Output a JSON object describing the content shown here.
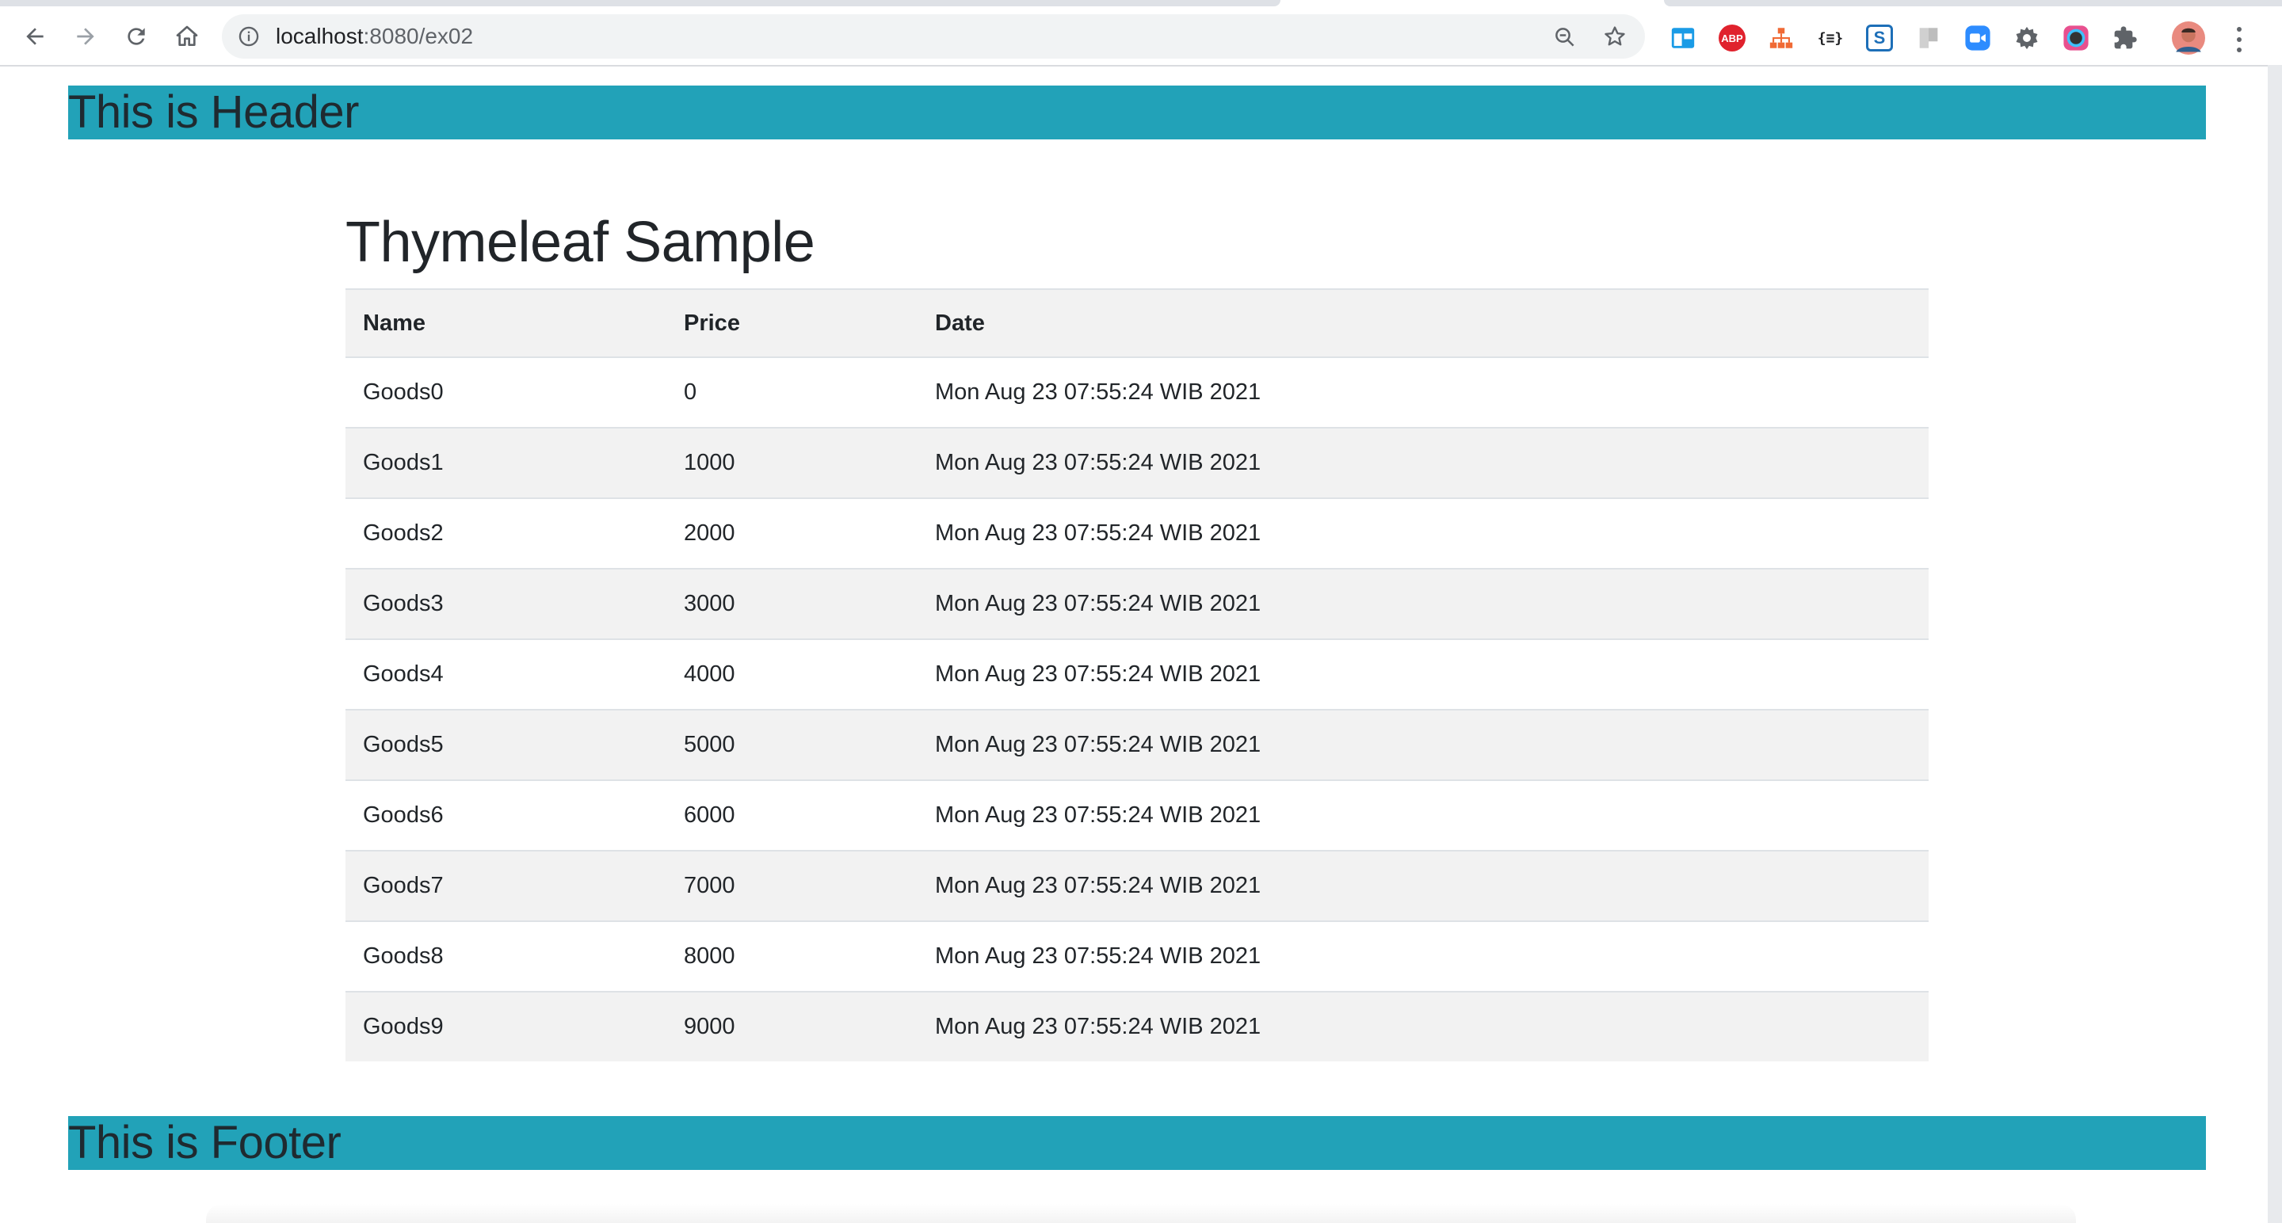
{
  "browser": {
    "url_host": "localhost",
    "url_path": ":8080/ex02",
    "nav": {
      "back": "back-icon",
      "forward": "forward-icon",
      "reload": "reload-icon",
      "home": "home-icon"
    },
    "extensions": [
      {
        "name": "window-ext-icon",
        "label": "",
        "color": "#1a9be6"
      },
      {
        "name": "adblock-icon",
        "label": "ABP",
        "color": "#e0222d"
      },
      {
        "name": "sitemap-ext-icon",
        "label": "",
        "color": "#f06a35"
      },
      {
        "name": "json-ext-icon",
        "label": "{≡}",
        "color": "#202124"
      },
      {
        "name": "s-ext-icon",
        "label": "S",
        "color": "#1d6fb8"
      },
      {
        "name": "grey-ext-icon",
        "label": "",
        "color": "#bdbdbd"
      },
      {
        "name": "zoom-ext-icon",
        "label": "",
        "color": "#2d8cff"
      },
      {
        "name": "gear-ext-icon",
        "label": "",
        "color": "#5f6368"
      },
      {
        "name": "color-picker-ext-icon",
        "label": "",
        "color": "#333333"
      },
      {
        "name": "extensions-puzzle-icon",
        "label": "",
        "color": "#5f6368"
      }
    ]
  },
  "page": {
    "header": "This is Header",
    "title": "Thymeleaf Sample",
    "footer": "This is Footer",
    "colors": {
      "bar": "#22a2b8",
      "stripe": "#f2f2f2"
    },
    "table": {
      "columns": [
        "Name",
        "Price",
        "Date"
      ],
      "rows": [
        [
          "Goods0",
          "0",
          "Mon Aug 23 07:55:24 WIB 2021"
        ],
        [
          "Goods1",
          "1000",
          "Mon Aug 23 07:55:24 WIB 2021"
        ],
        [
          "Goods2",
          "2000",
          "Mon Aug 23 07:55:24 WIB 2021"
        ],
        [
          "Goods3",
          "3000",
          "Mon Aug 23 07:55:24 WIB 2021"
        ],
        [
          "Goods4",
          "4000",
          "Mon Aug 23 07:55:24 WIB 2021"
        ],
        [
          "Goods5",
          "5000",
          "Mon Aug 23 07:55:24 WIB 2021"
        ],
        [
          "Goods6",
          "6000",
          "Mon Aug 23 07:55:24 WIB 2021"
        ],
        [
          "Goods7",
          "7000",
          "Mon Aug 23 07:55:24 WIB 2021"
        ],
        [
          "Goods8",
          "8000",
          "Mon Aug 23 07:55:24 WIB 2021"
        ],
        [
          "Goods9",
          "9000",
          "Mon Aug 23 07:55:24 WIB 2021"
        ]
      ]
    }
  }
}
